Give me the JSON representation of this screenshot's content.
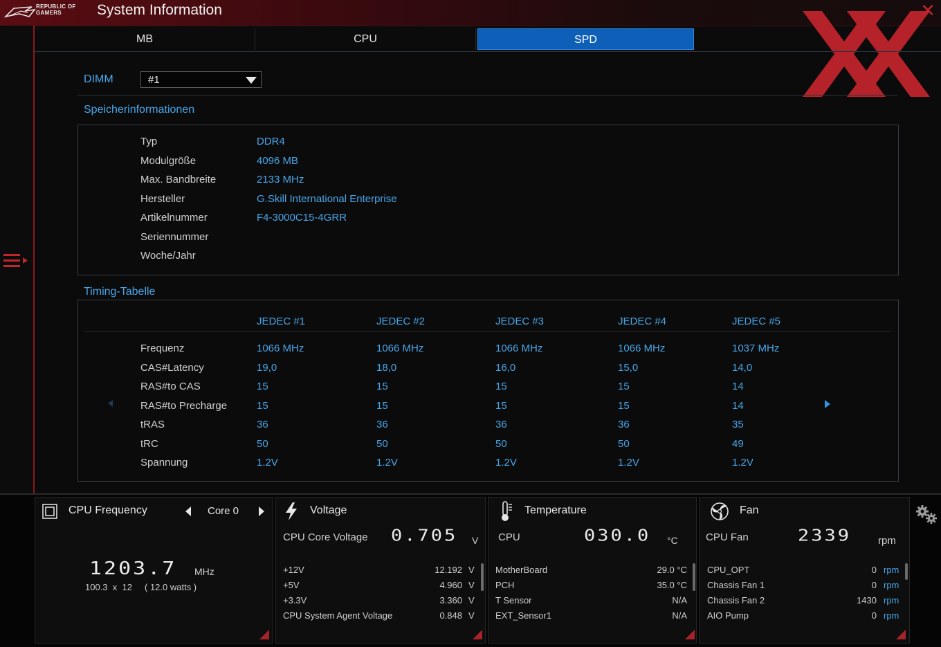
{
  "window": {
    "brand_line1": "REPUBLIC OF",
    "brand_line2": "GAMERS",
    "title": "System Information",
    "close_icon": "close-icon",
    "accent": "#c0262d"
  },
  "tabs": [
    {
      "label": "MB",
      "active": false
    },
    {
      "label": "CPU",
      "active": false
    },
    {
      "label": "SPD",
      "active": true
    }
  ],
  "dimm": {
    "label": "DIMM",
    "selected": "#1"
  },
  "memory_info": {
    "title": "Speicherinformationen",
    "rows": [
      {
        "label": "Typ",
        "value": "DDR4"
      },
      {
        "label": "Modulgröße",
        "value": "4096 MB"
      },
      {
        "label": "Max. Bandbreite",
        "value": "2133 MHz"
      },
      {
        "label": "Hersteller",
        "value": "G.Skill International Enterprise"
      },
      {
        "label": "Artikelnummer",
        "value": "F4-3000C15-4GRR"
      },
      {
        "label": "Seriennummer",
        "value": ""
      },
      {
        "label": "Woche/Jahr",
        "value": ""
      }
    ]
  },
  "timing": {
    "title": "Timing-Tabelle",
    "columns": [
      "JEDEC #1",
      "JEDEC #2",
      "JEDEC #3",
      "JEDEC #4",
      "JEDEC #5"
    ],
    "rows": [
      {
        "label": "Frequenz",
        "values": [
          "1066 MHz",
          "1066 MHz",
          "1066 MHz",
          "1066 MHz",
          "1037 MHz"
        ]
      },
      {
        "label": "CAS#Latency",
        "values": [
          "19,0",
          "18,0",
          "16,0",
          "15,0",
          "14,0"
        ]
      },
      {
        "label": "RAS#to CAS",
        "values": [
          "15",
          "15",
          "15",
          "15",
          "14"
        ]
      },
      {
        "label": "RAS#to Precharge",
        "values": [
          "15",
          "15",
          "15",
          "15",
          "14"
        ]
      },
      {
        "label": "tRAS",
        "values": [
          "36",
          "36",
          "36",
          "36",
          "35"
        ]
      },
      {
        "label": "tRC",
        "values": [
          "50",
          "50",
          "50",
          "50",
          "49"
        ]
      },
      {
        "label": "Spannung",
        "values": [
          "1.2V",
          "1.2V",
          "1.2V",
          "1.2V",
          "1.2V"
        ]
      }
    ]
  },
  "cpu_frequency": {
    "title": "CPU Frequency",
    "core_selected": "Core 0",
    "value": "1203.7",
    "unit": "MHz",
    "detail": "100.3  x  12     ( 12.0 watts )"
  },
  "voltage": {
    "title": "Voltage",
    "main_label": "CPU Core Voltage",
    "main_value": "0.705",
    "main_unit": "V",
    "rows": [
      {
        "label": "+12V",
        "value": "12.192",
        "unit": "V"
      },
      {
        "label": "+5V",
        "value": "4.960",
        "unit": "V"
      },
      {
        "label": "+3.3V",
        "value": "3.360",
        "unit": "V"
      },
      {
        "label": "CPU System Agent Voltage",
        "value": "0.848",
        "unit": "V"
      }
    ]
  },
  "temperature": {
    "title": "Temperature",
    "main_label": "CPU",
    "main_value": "030.0",
    "main_unit": "°C",
    "rows": [
      {
        "label": "MotherBoard",
        "value": "29.0 °C"
      },
      {
        "label": "PCH",
        "value": "35.0 °C"
      },
      {
        "label": "T Sensor",
        "value": "N/A"
      },
      {
        "label": "EXT_Sensor1",
        "value": "N/A"
      }
    ]
  },
  "fan": {
    "title": "Fan",
    "main_label": "CPU Fan",
    "main_value": "2339",
    "main_unit": "rpm",
    "rows": [
      {
        "label": "CPU_OPT",
        "value": "0",
        "unit": "rpm"
      },
      {
        "label": "Chassis Fan 1",
        "value": "0",
        "unit": "rpm"
      },
      {
        "label": "Chassis Fan 2",
        "value": "1430",
        "unit": "rpm"
      },
      {
        "label": "AIO Pump",
        "value": "0",
        "unit": "rpm"
      }
    ]
  },
  "colors": {
    "accent_blue": "#49a6e8",
    "tab_active": "#0e5fb8",
    "rog_red": "#a8222a"
  }
}
